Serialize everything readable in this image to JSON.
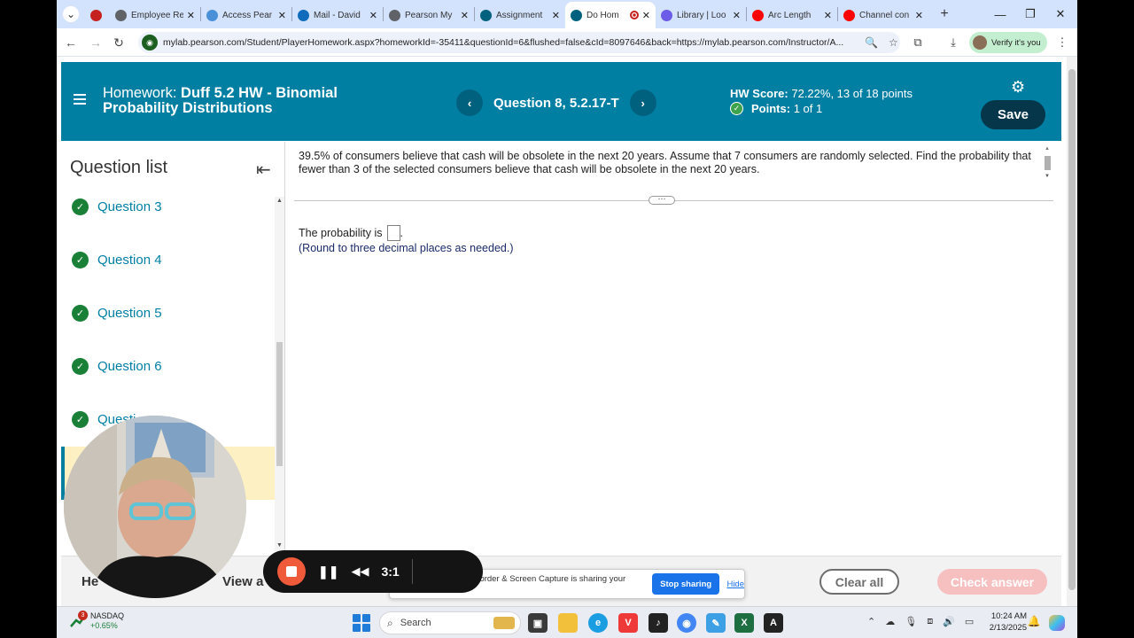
{
  "browser": {
    "tabs": [
      {
        "label": "",
        "icon": "record-icon",
        "color": "#c5221f"
      },
      {
        "label": "Employee Re",
        "icon": "globe-icon",
        "color": "#5f6368"
      },
      {
        "label": "Access Pear",
        "icon": "map-icon",
        "color": "#4a90d9"
      },
      {
        "label": "Mail - David",
        "icon": "outlook-icon",
        "color": "#0f6cbd"
      },
      {
        "label": "Pearson My",
        "icon": "globe-icon",
        "color": "#5f6368"
      },
      {
        "label": "Assignment",
        "icon": "pearson-icon",
        "color": "#00617f"
      },
      {
        "label": "Do Hom",
        "icon": "pearson-icon",
        "color": "#00617f"
      },
      {
        "label": "Library | Loo",
        "icon": "gear-icon",
        "color": "#6c5ce7"
      },
      {
        "label": "Arc Length",
        "icon": "youtube-icon",
        "color": "#ff0000"
      },
      {
        "label": "Channel con",
        "icon": "youtube-icon",
        "color": "#ff0000"
      }
    ],
    "url": "mylab.pearson.com/Student/PlayerHomework.aspx?homeworkId=-35411&questionId=6&flushed=false&cId=8097646&back=https://mylab.pearson.com/Instructor/A...",
    "verify_label": "Verify it's you"
  },
  "header": {
    "title_prefix": "Homework: ",
    "title_name": "Duff 5.2 HW - Binomial Probability Distributions",
    "question_label": "Question 8, 5.2.17-T",
    "score_label": "HW Score:",
    "score_value": "72.22%, 13 of 18 points",
    "points_label": "Points:",
    "points_value": "1 of 1",
    "save_label": "Save"
  },
  "sidebar": {
    "title": "Question list",
    "items": [
      {
        "label": "Question 3"
      },
      {
        "label": "Question 4"
      },
      {
        "label": "Question 5"
      },
      {
        "label": "Question 6"
      },
      {
        "label": "Questi"
      }
    ]
  },
  "question": {
    "text": "39.5% of consumers believe that cash will be obsolete in the next 20 years. Assume that 7 consumers are randomly selected. Find the probability that fewer than 3 of the selected consumers believe that cash will be obsolete in the next 20 years.",
    "answer_prefix": "The probability is",
    "answer_value": "",
    "answer_suffix": ".",
    "round_note": "(Round to three decimal places as needed.)"
  },
  "footer": {
    "help_label": "He",
    "view_label": "View a",
    "clear_label": "Clear all",
    "check_label": "Check answer"
  },
  "loom": {
    "message": "Loom – Screen Recorder & Screen Capture is sharing your screen.",
    "stop_label": "Stop sharing",
    "hide_label": "Hide",
    "timer": "3:1"
  },
  "taskbar": {
    "stock_name": "NASDAQ",
    "stock_change": "+0.65%",
    "badge_count": "3",
    "search_placeholder": "Search",
    "time": "10:24 AM",
    "date": "2/13/2025"
  }
}
